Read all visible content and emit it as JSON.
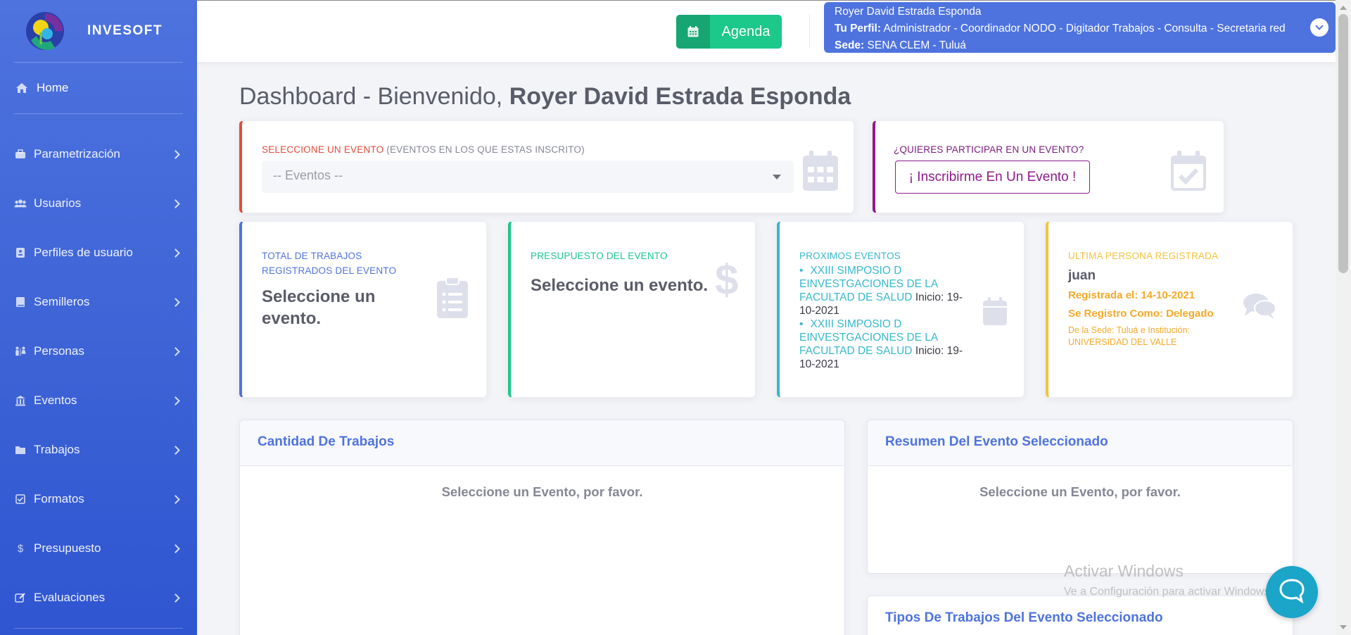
{
  "brand": {
    "name": "INVESOFT"
  },
  "sidebar": {
    "home": "Home",
    "items": [
      {
        "label": "Parametrización",
        "icon": "toolbox-icon"
      },
      {
        "label": "Usuarios",
        "icon": "users-icon"
      },
      {
        "label": "Perfiles de usuario",
        "icon": "id-card-icon"
      },
      {
        "label": "Semilleros",
        "icon": "book-icon"
      },
      {
        "label": "Personas",
        "icon": "people-icon"
      },
      {
        "label": "Eventos",
        "icon": "university-icon"
      },
      {
        "label": "Trabajos",
        "icon": "folder-icon"
      },
      {
        "label": "Formatos",
        "icon": "check-square-icon"
      },
      {
        "label": "Presupuesto",
        "icon": "dollar-icon"
      },
      {
        "label": "Evaluaciones",
        "icon": "edit-icon"
      }
    ]
  },
  "topbar": {
    "agenda_label": "Agenda",
    "user": {
      "name": "Royer David Estrada Esponda",
      "perfil_label": "Tu Perfil:",
      "perfil_value": "Administrador - Coordinador NODO - Digitador Trabajos - Consulta - Secretaria red",
      "sede_label": "Sede:",
      "sede_value": "SENA CLEM - Tuluá"
    }
  },
  "page": {
    "title_prefix": "Dashboard - Bienvenido,",
    "title_name": "Royer David Estrada Esponda"
  },
  "event_select": {
    "label": "SELECCIONE UN EVENTO",
    "label_note": "(EVENTOS EN LOS QUE ESTAS INSCRITO)",
    "selected": "-- Eventos --"
  },
  "participate": {
    "label": "¿QUIERES PARTICIPAR EN UN EVENTO?",
    "button": "¡ Inscribirme En Un Evento !"
  },
  "stats": {
    "trabajos": {
      "label": "TOTAL DE TRABAJOS REGISTRADOS DEL EVENTO",
      "value": "Seleccione un evento."
    },
    "presupuesto": {
      "label": "PRESUPUESTO DEL EVENTO",
      "value": "Seleccione un evento."
    },
    "proximos": {
      "label": "PROXIMOS EVENTOS",
      "items": [
        {
          "name": "XXIII SIMPOSIO D EINVESTGACIONES DE LA FACULTAD DE SALUD",
          "start": "Inicio: 19-10-2021"
        },
        {
          "name": "XXIII SIMPOSIO D EINVESTGACIONES DE LA FACULTAD DE SALUD",
          "start": "Inicio: 19-10-2021"
        }
      ]
    },
    "ultima": {
      "label": "ULTIMA PERSONA REGISTRADA",
      "name": "juan",
      "registrada": "Registrada el: 14-10-2021",
      "rol": "Se Registro Como: Delegado",
      "sede": "De la Sede: Tuluá e Institución: UNIVERSIDAD DEL VALLE"
    }
  },
  "panels": {
    "cantidad": {
      "title": "Cantidad De Trabajos",
      "body": "Seleccione un Evento, por favor."
    },
    "resumen": {
      "title": "Resumen Del Evento Seleccionado",
      "body": "Seleccione un Evento, por favor."
    },
    "tipos": {
      "title": "Tipos De Trabajos Del Evento Seleccionado"
    }
  },
  "watermark": {
    "line1": "Activar Windows",
    "line2": "Ve a Configuración para activar Windows."
  },
  "colors": {
    "primary": "#4e73df",
    "success": "#1cc88a",
    "info": "#36b9cc",
    "warning": "#f6c23e",
    "danger": "#e74a3b",
    "purple": "#8e1b8a"
  }
}
